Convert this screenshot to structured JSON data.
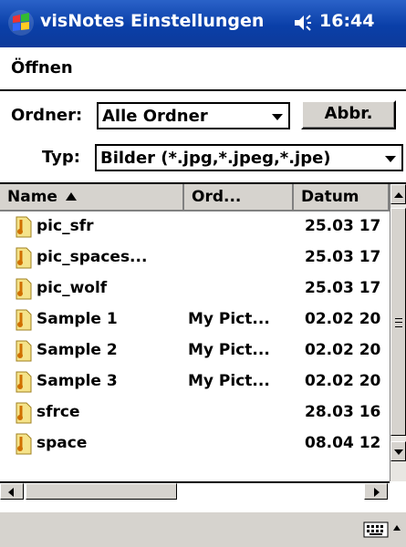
{
  "titlebar": {
    "title": "visNotes Einstellungen",
    "time": "16:44",
    "start_icon": "windows-flag-icon",
    "volume_icon": "speaker-icon"
  },
  "header": {
    "title": "Öffnen"
  },
  "form": {
    "folder_label": "Ordner:",
    "folder_value": "Alle Ordner",
    "cancel_label": "Abbr.",
    "type_label": "Typ:",
    "type_value": "Bilder (*.jpg,*.jpeg,*.jpe)"
  },
  "list": {
    "columns": [
      "Name",
      "Ord...",
      "Datum"
    ],
    "sort_icon": "sort-ascending-icon",
    "file_icon": "image-file-icon",
    "rows": [
      {
        "name": "pic_sfr",
        "folder": "",
        "date": "25.03 17"
      },
      {
        "name": "pic_spaces...",
        "folder": "",
        "date": "25.03 17"
      },
      {
        "name": "pic_wolf",
        "folder": "",
        "date": "25.03 17"
      },
      {
        "name": "Sample 1",
        "folder": "My Pict...",
        "date": "02.02 20"
      },
      {
        "name": "Sample 2",
        "folder": "My Pict...",
        "date": "02.02 20"
      },
      {
        "name": "Sample 3",
        "folder": "My Pict...",
        "date": "02.02 20"
      },
      {
        "name": "sfrce",
        "folder": "",
        "date": "28.03 16"
      },
      {
        "name": "space",
        "folder": "",
        "date": "08.04 12"
      }
    ]
  },
  "bottombar": {
    "keyboard_icon": "keyboard-icon",
    "sip_arrow_icon": "sip-up-arrow-icon"
  },
  "colors": {
    "titlebar": "#0a3fa8",
    "chrome": "#d6d3ce"
  }
}
